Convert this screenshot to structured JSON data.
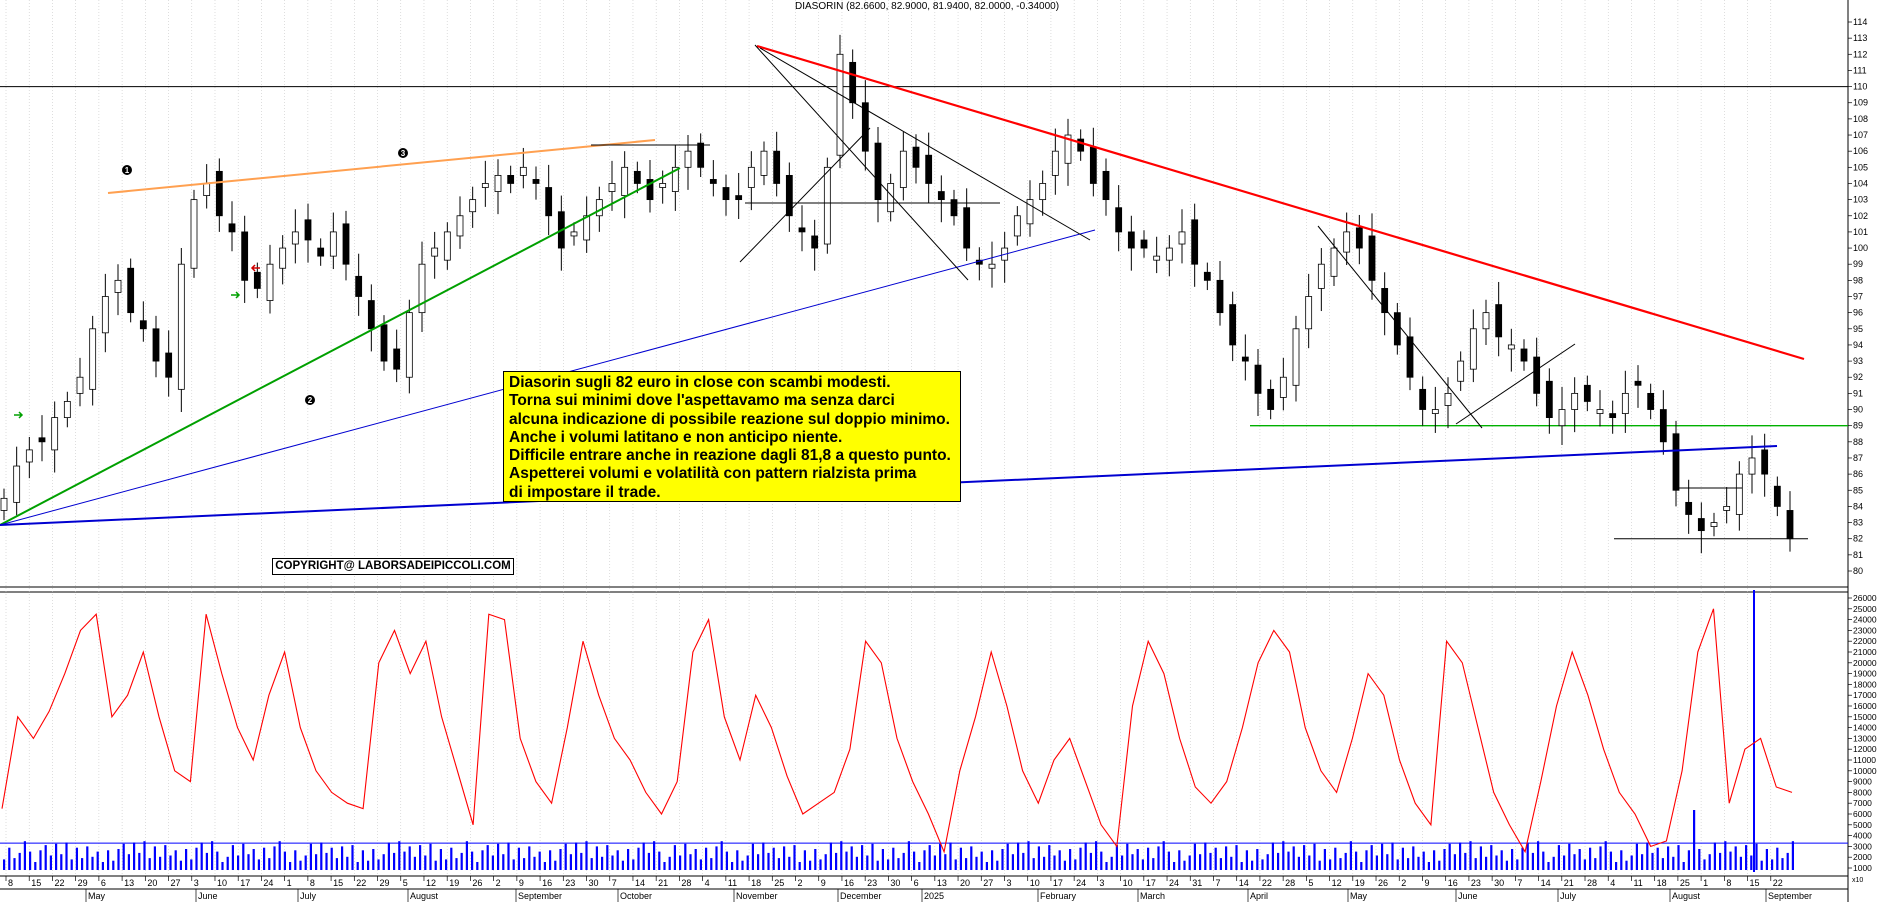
{
  "chart_data": [
    {
      "type": "candlestick",
      "title": "DIASORIN (82.6600, 82.9000, 81.9400, 82.0000, -0.34000)",
      "ylim": [
        79,
        115
      ],
      "y_ticks": [
        80,
        81,
        82,
        83,
        84,
        85,
        86,
        87,
        88,
        89,
        90,
        91,
        92,
        93,
        94,
        95,
        96,
        97,
        98,
        99,
        100,
        101,
        102,
        103,
        104,
        105,
        106,
        107,
        108,
        109,
        110,
        111,
        112,
        113,
        114
      ],
      "grid": "vertical",
      "series": [
        {
          "name": "",
          "values": [
            84.5,
            86.5,
            87.5,
            88,
            89.5,
            90.5,
            92,
            95,
            97,
            98,
            96,
            95,
            93,
            92,
            99,
            103,
            104,
            102,
            101,
            98,
            97.5,
            99,
            100,
            101,
            100.5,
            99.5,
            101,
            99,
            97,
            95,
            93,
            92.5,
            96,
            99,
            100,
            101,
            102,
            103,
            104,
            104.5,
            104,
            105,
            104,
            102,
            100,
            101,
            102,
            103,
            104,
            105,
            104,
            103,
            104,
            105,
            106,
            105,
            104,
            103,
            103,
            105,
            106,
            104,
            102,
            101,
            100,
            105,
            112,
            109,
            106,
            103,
            104,
            106,
            105,
            104,
            103,
            102,
            100,
            99,
            99,
            100,
            102,
            103,
            104,
            106,
            107,
            106,
            104,
            103,
            101,
            100,
            100,
            99.5,
            100,
            101,
            99,
            98,
            96,
            94,
            93,
            91,
            90,
            92,
            95,
            97,
            99,
            100,
            101,
            100,
            98,
            96,
            94,
            92,
            90,
            90,
            91,
            93,
            95,
            96,
            94.5,
            94,
            93,
            91,
            89.5,
            90,
            91,
            90.5,
            90,
            89.5,
            91,
            91.5,
            90,
            88,
            85,
            83.5,
            82.5,
            83,
            84,
            86,
            87,
            86,
            84,
            82
          ]
        }
      ],
      "trendlines": [
        "resistance",
        "support",
        "neckline"
      ],
      "annotations": {
        "markers": [
          "1",
          "2",
          "3"
        ],
        "levels": [
          110,
          89,
          82
        ]
      }
    },
    {
      "type": "line",
      "ylim": [
        0,
        26000
      ],
      "y_ticks_labels": [
        "26000",
        "25000",
        "24000",
        "23000",
        "22000",
        "21000",
        "20000",
        "19000",
        "18000",
        "17000",
        "16000",
        "15000",
        "14000",
        "13000",
        "12000",
        "11000",
        "10000",
        "9000",
        "8000",
        "7000",
        "6000",
        "5000",
        "4000",
        "3000",
        "2000",
        "1000"
      ],
      "series": [
        {
          "name": "",
          "values": [
            6500,
            15000,
            13000,
            15500,
            19000,
            23000,
            24500,
            15000,
            17000,
            21000,
            15000,
            10000,
            9000,
            24500,
            19000,
            14000,
            11000,
            17000,
            21000,
            14000,
            10000,
            8000,
            7000,
            6500,
            20000,
            23000,
            19000,
            22000,
            15000,
            10000,
            5000,
            24500,
            24000,
            13000,
            9000,
            7000,
            14000,
            22000,
            17000,
            13000,
            11000,
            8000,
            6000,
            9000,
            21000,
            24000,
            15000,
            11000,
            17000,
            14000,
            9500,
            6000,
            7000,
            8000,
            12000,
            22000,
            20000,
            13000,
            9000,
            6000,
            2500,
            10000,
            15000,
            21000,
            16000,
            10000,
            7000,
            11000,
            13000,
            9000,
            5000,
            3000,
            16000,
            22000,
            19000,
            13000,
            8500,
            7000,
            9000,
            14000,
            20000,
            23000,
            21000,
            14000,
            10000,
            8000,
            13000,
            19000,
            17000,
            11000,
            7000,
            5000,
            22000,
            20000,
            14000,
            8000,
            5000,
            2500,
            9000,
            16000,
            21000,
            17000,
            12000,
            8000,
            6000,
            3000,
            3500,
            10000,
            21000,
            25000,
            7000,
            12000,
            13000,
            8500,
            8000
          ]
        }
      ]
    }
  ],
  "x_axis": {
    "day_labels": [
      "8",
      "15",
      "22",
      "29",
      "6",
      "13",
      "20",
      "27",
      "3",
      "10",
      "17",
      "24",
      "1",
      "8",
      "15",
      "22",
      "29",
      "5",
      "12",
      "19",
      "26",
      "2",
      "9",
      "16",
      "23",
      "30",
      "7",
      "14",
      "21",
      "28",
      "4",
      "11",
      "18",
      "25",
      "2",
      "9",
      "16",
      "23",
      "30",
      "6",
      "13",
      "20",
      "27",
      "3",
      "10",
      "17",
      "24",
      "3",
      "10",
      "17",
      "24",
      "31",
      "7",
      "14",
      "22",
      "28",
      "5",
      "12",
      "19",
      "26",
      "2",
      "9",
      "16",
      "23",
      "30",
      "7",
      "14",
      "21",
      "28",
      "4",
      "11",
      "18",
      "25",
      "1",
      "8",
      "15",
      "22"
    ],
    "month_labels": [
      "May",
      "June",
      "July",
      "August",
      "September",
      "October",
      "November",
      "December",
      "2025",
      "February",
      "March",
      "April",
      "May",
      "June",
      "July",
      "August",
      "September"
    ]
  },
  "note_text": "Diasorin sugli 82 euro in close con scambi modesti.\nTorna sui minimi dove l'aspettavamo ma senza darci\nalcuna indicazione di possibile reazione sul doppio minimo.\nAnche i volumi latitano e non anticipo niente.\nDifficile entrare anche in reazione dagli 81,8 a questo punto.\nAspetterei volumi e volatilità con pattern rialzista prima\ndi impostare il trade.",
  "copyright": "COPYRIGHT@ LABORSADEIPICCOLI.COM",
  "volume_unit": "x10",
  "colors": {
    "red_trendline": "#ff0000",
    "green_trendline": "#00a000",
    "blue_trendline": "#0000d0",
    "orange_trendline": "#ffa050",
    "oscillator": "#ff0000",
    "volume": "#0000ff",
    "note_bg": "#ffff00"
  }
}
